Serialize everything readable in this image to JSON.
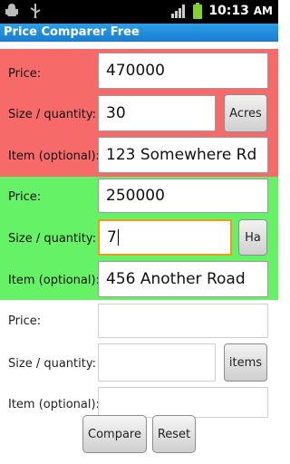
{
  "status_bar": {
    "time": "10:13",
    "ampm": "AM",
    "icons": [
      "android-debug-icon",
      "usb-icon",
      "signal-icon",
      "battery-icon"
    ]
  },
  "app": {
    "title": "Price Comparer Free"
  },
  "items": [
    {
      "color": "#f76a6a",
      "price_label": "Price:",
      "price_value": "470000",
      "size_label": "Size / quantity:",
      "size_value": "30",
      "unit_label": "Acres",
      "item_label": "Item (optional):",
      "item_value": "123 Somewhere Rd"
    },
    {
      "color": "#66f266",
      "price_label": "Price:",
      "price_value": "250000",
      "size_label": "Size / quantity:",
      "size_value": "7",
      "unit_label": "Ha",
      "item_label": "Item (optional):",
      "item_value": "456 Another Road"
    },
    {
      "color": "#ffffff",
      "price_label": "Price:",
      "price_value": "",
      "size_label": "Size / quantity:",
      "size_value": "",
      "unit_label": "items",
      "item_label": "Item (optional):",
      "item_value": ""
    }
  ],
  "buttons": {
    "compare": "Compare",
    "reset": "Reset"
  },
  "colors": {
    "title_bar": "#1a7bd0",
    "focus_border": "#f29b12"
  }
}
